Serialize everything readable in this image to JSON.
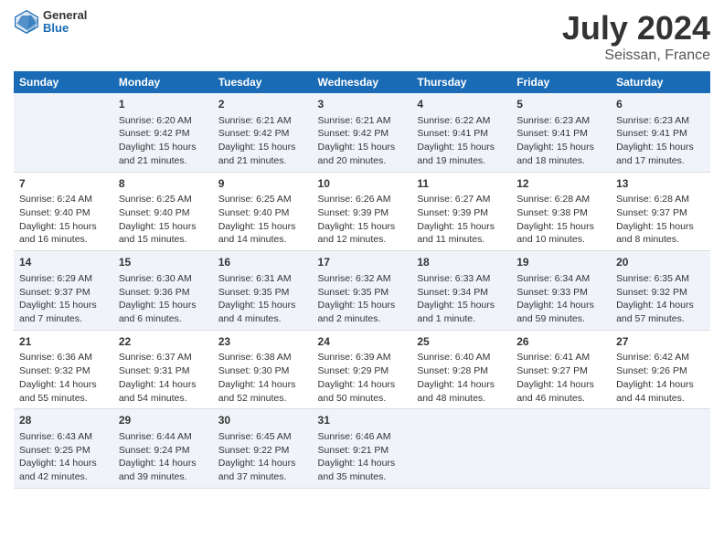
{
  "header": {
    "logo_general": "General",
    "logo_blue": "Blue",
    "title": "July 2024",
    "subtitle": "Seissan, France"
  },
  "columns": [
    "Sunday",
    "Monday",
    "Tuesday",
    "Wednesday",
    "Thursday",
    "Friday",
    "Saturday"
  ],
  "weeks": [
    [
      {
        "day": "",
        "content": ""
      },
      {
        "day": "1",
        "content": "Sunrise: 6:20 AM\nSunset: 9:42 PM\nDaylight: 15 hours\nand 21 minutes."
      },
      {
        "day": "2",
        "content": "Sunrise: 6:21 AM\nSunset: 9:42 PM\nDaylight: 15 hours\nand 21 minutes."
      },
      {
        "day": "3",
        "content": "Sunrise: 6:21 AM\nSunset: 9:42 PM\nDaylight: 15 hours\nand 20 minutes."
      },
      {
        "day": "4",
        "content": "Sunrise: 6:22 AM\nSunset: 9:41 PM\nDaylight: 15 hours\nand 19 minutes."
      },
      {
        "day": "5",
        "content": "Sunrise: 6:23 AM\nSunset: 9:41 PM\nDaylight: 15 hours\nand 18 minutes."
      },
      {
        "day": "6",
        "content": "Sunrise: 6:23 AM\nSunset: 9:41 PM\nDaylight: 15 hours\nand 17 minutes."
      }
    ],
    [
      {
        "day": "7",
        "content": "Sunrise: 6:24 AM\nSunset: 9:40 PM\nDaylight: 15 hours\nand 16 minutes."
      },
      {
        "day": "8",
        "content": "Sunrise: 6:25 AM\nSunset: 9:40 PM\nDaylight: 15 hours\nand 15 minutes."
      },
      {
        "day": "9",
        "content": "Sunrise: 6:25 AM\nSunset: 9:40 PM\nDaylight: 15 hours\nand 14 minutes."
      },
      {
        "day": "10",
        "content": "Sunrise: 6:26 AM\nSunset: 9:39 PM\nDaylight: 15 hours\nand 12 minutes."
      },
      {
        "day": "11",
        "content": "Sunrise: 6:27 AM\nSunset: 9:39 PM\nDaylight: 15 hours\nand 11 minutes."
      },
      {
        "day": "12",
        "content": "Sunrise: 6:28 AM\nSunset: 9:38 PM\nDaylight: 15 hours\nand 10 minutes."
      },
      {
        "day": "13",
        "content": "Sunrise: 6:28 AM\nSunset: 9:37 PM\nDaylight: 15 hours\nand 8 minutes."
      }
    ],
    [
      {
        "day": "14",
        "content": "Sunrise: 6:29 AM\nSunset: 9:37 PM\nDaylight: 15 hours\nand 7 minutes."
      },
      {
        "day": "15",
        "content": "Sunrise: 6:30 AM\nSunset: 9:36 PM\nDaylight: 15 hours\nand 6 minutes."
      },
      {
        "day": "16",
        "content": "Sunrise: 6:31 AM\nSunset: 9:35 PM\nDaylight: 15 hours\nand 4 minutes."
      },
      {
        "day": "17",
        "content": "Sunrise: 6:32 AM\nSunset: 9:35 PM\nDaylight: 15 hours\nand 2 minutes."
      },
      {
        "day": "18",
        "content": "Sunrise: 6:33 AM\nSunset: 9:34 PM\nDaylight: 15 hours\nand 1 minute."
      },
      {
        "day": "19",
        "content": "Sunrise: 6:34 AM\nSunset: 9:33 PM\nDaylight: 14 hours\nand 59 minutes."
      },
      {
        "day": "20",
        "content": "Sunrise: 6:35 AM\nSunset: 9:32 PM\nDaylight: 14 hours\nand 57 minutes."
      }
    ],
    [
      {
        "day": "21",
        "content": "Sunrise: 6:36 AM\nSunset: 9:32 PM\nDaylight: 14 hours\nand 55 minutes."
      },
      {
        "day": "22",
        "content": "Sunrise: 6:37 AM\nSunset: 9:31 PM\nDaylight: 14 hours\nand 54 minutes."
      },
      {
        "day": "23",
        "content": "Sunrise: 6:38 AM\nSunset: 9:30 PM\nDaylight: 14 hours\nand 52 minutes."
      },
      {
        "day": "24",
        "content": "Sunrise: 6:39 AM\nSunset: 9:29 PM\nDaylight: 14 hours\nand 50 minutes."
      },
      {
        "day": "25",
        "content": "Sunrise: 6:40 AM\nSunset: 9:28 PM\nDaylight: 14 hours\nand 48 minutes."
      },
      {
        "day": "26",
        "content": "Sunrise: 6:41 AM\nSunset: 9:27 PM\nDaylight: 14 hours\nand 46 minutes."
      },
      {
        "day": "27",
        "content": "Sunrise: 6:42 AM\nSunset: 9:26 PM\nDaylight: 14 hours\nand 44 minutes."
      }
    ],
    [
      {
        "day": "28",
        "content": "Sunrise: 6:43 AM\nSunset: 9:25 PM\nDaylight: 14 hours\nand 42 minutes."
      },
      {
        "day": "29",
        "content": "Sunrise: 6:44 AM\nSunset: 9:24 PM\nDaylight: 14 hours\nand 39 minutes."
      },
      {
        "day": "30",
        "content": "Sunrise: 6:45 AM\nSunset: 9:22 PM\nDaylight: 14 hours\nand 37 minutes."
      },
      {
        "day": "31",
        "content": "Sunrise: 6:46 AM\nSunset: 9:21 PM\nDaylight: 14 hours\nand 35 minutes."
      },
      {
        "day": "",
        "content": ""
      },
      {
        "day": "",
        "content": ""
      },
      {
        "day": "",
        "content": ""
      }
    ]
  ]
}
